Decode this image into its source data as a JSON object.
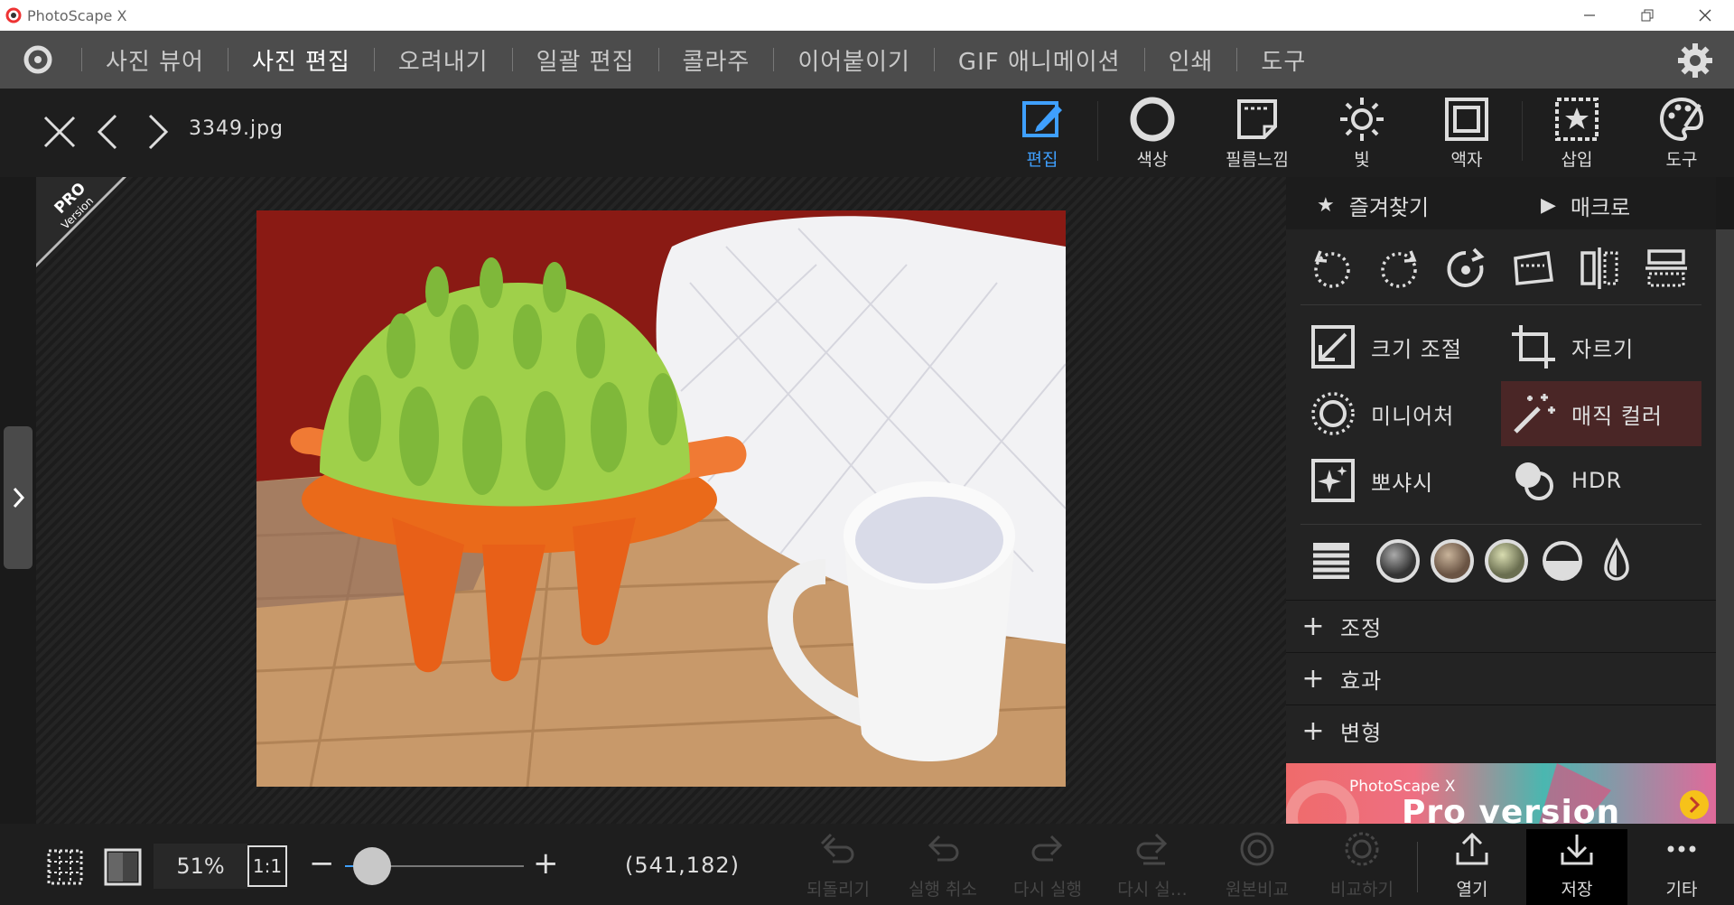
{
  "window": {
    "title": "PhotoScape X"
  },
  "menu": {
    "items": [
      {
        "label": "사진 뷰어",
        "active": false
      },
      {
        "label": "사진 편집",
        "active": true
      },
      {
        "label": "오려내기",
        "active": false
      },
      {
        "label": "일괄 편집",
        "active": false
      },
      {
        "label": "콜라주",
        "active": false
      },
      {
        "label": "이어붙이기",
        "active": false
      },
      {
        "label": "GIF 애니메이션",
        "active": false
      },
      {
        "label": "인쇄",
        "active": false
      },
      {
        "label": "도구",
        "active": false
      }
    ]
  },
  "file": {
    "name": "3349.jpg"
  },
  "tools": [
    {
      "label": "편집",
      "icon": "edit-icon",
      "active": true
    },
    {
      "label": "색상",
      "icon": "color-circle-icon"
    },
    {
      "label": "필름느낌",
      "icon": "film-icon"
    },
    {
      "label": "빛",
      "icon": "sun-icon"
    },
    {
      "label": "액자",
      "icon": "frame-icon"
    },
    {
      "label": "삽입",
      "icon": "insert-star-icon"
    },
    {
      "label": "도구",
      "icon": "palette-icon"
    }
  ],
  "badge": {
    "line1": "PRO",
    "line2": "Version"
  },
  "panel": {
    "favorites": "즐겨찾기",
    "macro": "매크로",
    "features": [
      {
        "label": "크기 조절",
        "icon": "resize-icon"
      },
      {
        "label": "자르기",
        "icon": "crop-icon"
      },
      {
        "label": "미니어처",
        "icon": "miniature-icon"
      },
      {
        "label": "매직 컬러",
        "icon": "magic-wand-icon",
        "highlighted": true
      },
      {
        "label": "뽀샤시",
        "icon": "sparkle-icon"
      },
      {
        "label": "HDR",
        "icon": "hdr-icon"
      }
    ],
    "sections": [
      {
        "label": "조정"
      },
      {
        "label": "효과"
      },
      {
        "label": "변형"
      }
    ],
    "ad": {
      "line1": "PhotoScape X",
      "line2": "Pro version"
    }
  },
  "bottom": {
    "zoom": "51%",
    "one_to_one": "1:1",
    "zoom_level": 0.15,
    "coords": "(541,182)",
    "actions": [
      {
        "label": "되돌리기",
        "enabled": false
      },
      {
        "label": "실행 취소",
        "enabled": false
      },
      {
        "label": "다시 실행",
        "enabled": false
      },
      {
        "label": "다시 실…",
        "enabled": false
      },
      {
        "label": "원본비교",
        "enabled": false
      },
      {
        "label": "비교하기",
        "enabled": false
      },
      {
        "label": "열기",
        "enabled": true
      },
      {
        "label": "저장",
        "enabled": true,
        "selected": true
      },
      {
        "label": "기타",
        "enabled": true
      }
    ]
  },
  "colors": {
    "accent": "#3fa0ff",
    "menubar": "#4c4c4c",
    "highlight": "#4a2626"
  }
}
